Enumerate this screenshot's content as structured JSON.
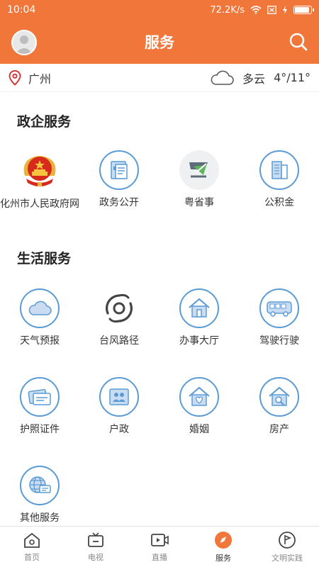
{
  "status_bar": {
    "time": "10:04",
    "net_speed": "72.2K/s",
    "battery_level": 0.95
  },
  "header": {
    "title": "服务",
    "avatar_icon": "avatar-icon",
    "search_icon": "search-icon"
  },
  "weather": {
    "location": "广州",
    "condition": "多云",
    "temperature": "4°/11°"
  },
  "gov_section": {
    "title": "政企服务",
    "items": [
      {
        "label": "化州市人民政府网",
        "icon": "national-emblem-icon"
      },
      {
        "label": "政务公开",
        "icon": "document-icon"
      },
      {
        "label": "粤省事",
        "icon": "yueshengshi-logo-icon"
      },
      {
        "label": "公积金",
        "icon": "housing-fund-icon"
      }
    ]
  },
  "life_section": {
    "title": "生活服务",
    "items": [
      {
        "label": "天气预报",
        "icon": "cloud-icon"
      },
      {
        "label": "台风路径",
        "icon": "typhoon-icon"
      },
      {
        "label": "办事大厅",
        "icon": "hall-icon"
      },
      {
        "label": "驾驶行驶",
        "icon": "bus-icon"
      },
      {
        "label": "护照证件",
        "icon": "passport-icon"
      },
      {
        "label": "户政",
        "icon": "household-icon"
      },
      {
        "label": "婚姻",
        "icon": "marriage-icon"
      },
      {
        "label": "房产",
        "icon": "property-icon"
      },
      {
        "label": "其他服务",
        "icon": "globe-chat-icon"
      }
    ]
  },
  "tabbar": {
    "tabs": [
      {
        "label": "首页",
        "icon": "home-icon"
      },
      {
        "label": "电视",
        "icon": "tv-icon"
      },
      {
        "label": "直播",
        "icon": "live-icon"
      },
      {
        "label": "服务",
        "icon": "compass-icon",
        "active": true
      },
      {
        "label": "文明实践",
        "icon": "flag-icon"
      }
    ]
  },
  "colors": {
    "accent": "#f0763a",
    "icon_blue": "#5b9bd5"
  }
}
